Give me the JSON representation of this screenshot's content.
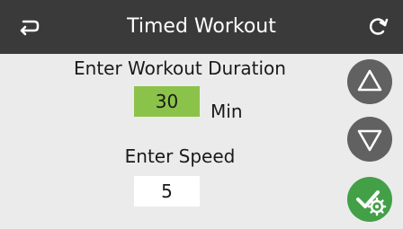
{
  "header": {
    "title": "Timed Workout",
    "back_icon": "back-arrow-icon",
    "refresh_icon": "refresh-icon"
  },
  "duration": {
    "label": "Enter Workout Duration",
    "value": "30",
    "unit": "Min"
  },
  "speed": {
    "label": "Enter Speed",
    "value": "5"
  },
  "controls": {
    "up_icon": "triangle-up-icon",
    "down_icon": "triangle-down-icon",
    "confirm_icon": "check-gear-icon"
  },
  "colors": {
    "header_bg": "#3a3a3a",
    "background": "#ebebeb",
    "selected_field": "#8bc34a",
    "button_gray": "#616161",
    "confirm_green": "#43a047"
  }
}
